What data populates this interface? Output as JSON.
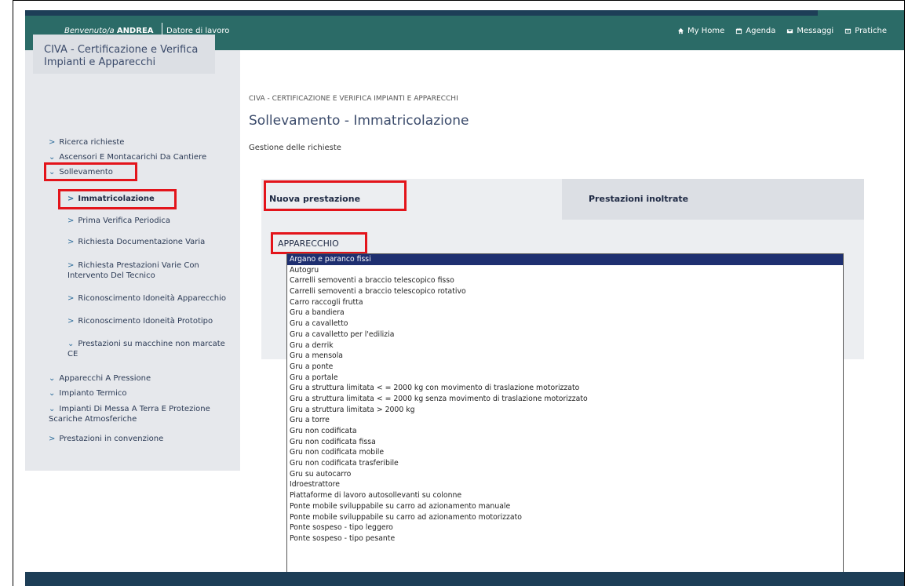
{
  "header": {
    "welcome_prefix": "Benvenuto/a",
    "user_name": "ANDREA",
    "employer_label": "Datore di lavoro",
    "nav": [
      {
        "label": "My Home",
        "icon": "home-icon"
      },
      {
        "label": "Agenda",
        "icon": "calendar-icon"
      },
      {
        "label": "Messaggi",
        "icon": "mail-icon"
      },
      {
        "label": "Pratiche",
        "icon": "folder-icon"
      }
    ]
  },
  "sidebar": {
    "title": "CIVA - Certificazione e Verifica Impianti e Apparecchi",
    "items": [
      {
        "label": "Ricerca richieste",
        "chev": ">"
      },
      {
        "label": "Ascensori E Montacarichi Da Cantiere",
        "chev": "⌄"
      },
      {
        "label": "Sollevamento",
        "chev": "⌄"
      },
      {
        "label": "Immatricolazione",
        "chev": ">"
      },
      {
        "label": "Prima Verifica Periodica",
        "chev": ">"
      },
      {
        "label": "Richiesta Documentazione Varia",
        "chev": ">"
      },
      {
        "label": "Richiesta Prestazioni Varie Con Intervento Del Tecnico",
        "chev": ">"
      },
      {
        "label": "Riconoscimento Idoneità Apparecchio",
        "chev": ">"
      },
      {
        "label": "Riconoscimento Idoneità Prototipo",
        "chev": ">"
      },
      {
        "label": "Prestazioni su macchine non marcate CE",
        "chev": "⌄"
      },
      {
        "label": "Apparecchi A Pressione",
        "chev": "⌄"
      },
      {
        "label": "Impianto Termico",
        "chev": "⌄"
      },
      {
        "label": "Impianti Di Messa A Terra E Protezione Scariche Atmosferiche",
        "chev": "⌄"
      },
      {
        "label": "Prestazioni in convenzione",
        "chev": ">"
      }
    ]
  },
  "main": {
    "breadcrumb": "CIVA - CERTIFICAZIONE E VERIFICA IMPIANTI E APPARECCHI",
    "title": "Sollevamento - Immatricolazione",
    "subtitle": "Gestione delle richieste",
    "tabs": [
      {
        "label": "Nuova prestazione"
      },
      {
        "label": "Prestazioni inoltrate"
      }
    ],
    "field_label": "APPARECCHIO",
    "dropdown_options": [
      "Argano e paranco fissi",
      "Autogru",
      "Carrelli semoventi a braccio telescopico fisso",
      "Carrelli semoventi a braccio telescopico rotativo",
      "Carro raccogli frutta",
      "Gru a bandiera",
      "Gru a cavalletto",
      "Gru a cavalletto per l'edilizia",
      "Gru a derrik",
      "Gru a mensola",
      "Gru a ponte",
      "Gru a portale",
      "Gru a struttura limitata < = 2000 kg con movimento di traslazione motorizzato",
      "Gru a struttura limitata < = 2000 kg senza movimento di traslazione motorizzato",
      "Gru a struttura limitata > 2000 kg",
      "Gru a torre",
      "Gru non codificata",
      "Gru non codificata fissa",
      "Gru non codificata mobile",
      "Gru non codificata trasferibile",
      "Gru su autocarro",
      "Idroestrattore",
      "Piattaforme di lavoro autosollevanti su colonne",
      "Ponte mobile sviluppabile su carro ad azionamento manuale",
      "Ponte mobile sviluppabile su carro ad azionamento motorizzato",
      "Ponte sospeso - tipo leggero",
      "Ponte sospeso - tipo pesante"
    ],
    "selected_option": "Argano e paranco fissi"
  },
  "colors": {
    "header": "#2b6b67",
    "header_top": "#1d3e57",
    "highlight": "#e3141b",
    "selected": "#1e2f70"
  }
}
